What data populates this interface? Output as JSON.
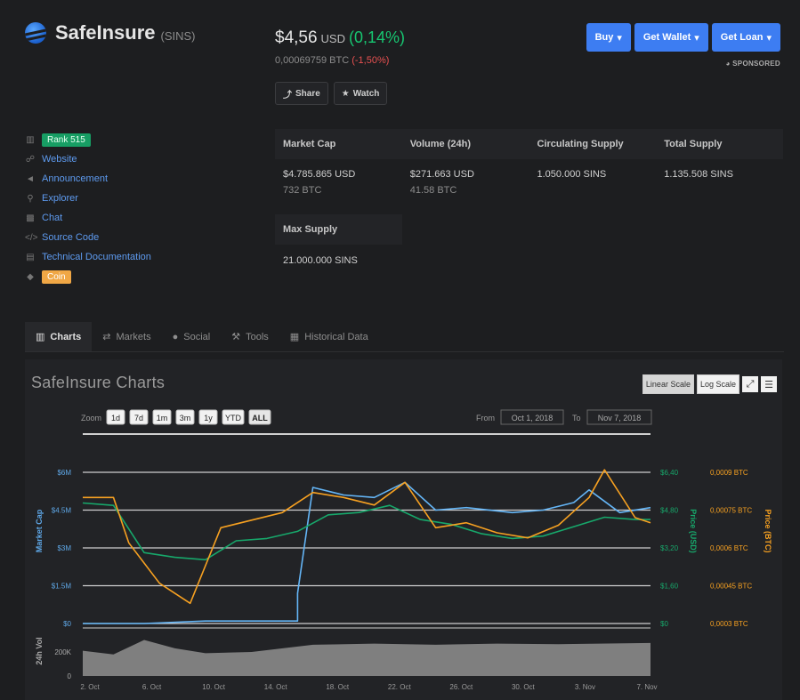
{
  "coin": {
    "name": "SafeInsure",
    "symbol": "(SINS)"
  },
  "price": {
    "usd": "$4,56",
    "usd_unit": "USD",
    "usd_change": "(0,14%)",
    "btc": "0,00069759 BTC",
    "btc_change": "(-1,50%)"
  },
  "buttons": {
    "share": "Share",
    "watch": "Watch",
    "buy": "Buy",
    "get_wallet": "Get Wallet",
    "get_loan": "Get Loan",
    "sponsored": "SPONSORED"
  },
  "links": {
    "rank": "Rank 515",
    "website": "Website",
    "announcement": "Announcement",
    "explorer": "Explorer",
    "chat": "Chat",
    "source_code": "Source Code",
    "technical_docs": "Technical Documentation",
    "coin_tag": "Coin"
  },
  "stats": {
    "headers": [
      "Market Cap",
      "Volume (24h)",
      "Circulating Supply",
      "Total Supply"
    ],
    "market_cap": {
      "usd": "$4.785.865 USD",
      "btc": "732 BTC"
    },
    "volume": {
      "usd": "$271.663 USD",
      "btc": "41.58 BTC"
    },
    "circulating": "1.050.000 SINS",
    "total": "1.135.508 SINS",
    "max_header": "Max Supply",
    "max": "21.000.000 SINS"
  },
  "tabs": [
    "Charts",
    "Markets",
    "Social",
    "Tools",
    "Historical Data"
  ],
  "colors": {
    "accent": "#3d7df2",
    "positive": "#17c671",
    "negative": "#e85151",
    "market_cap_line": "#64b5f6",
    "usd_line": "#17a86b",
    "btc_line": "#f7a121",
    "volume_bars": "#8a8a8a"
  },
  "chart_data": {
    "type": "line",
    "title": "SafeInsure Charts",
    "zoom_label": "Zoom",
    "zoom_buttons": [
      "1d",
      "7d",
      "1m",
      "3m",
      "1y",
      "YTD",
      "ALL"
    ],
    "zoom_selected": "ALL",
    "from_label": "From",
    "from": "Oct 1, 2018",
    "to_label": "To",
    "to": "Nov 7, 2018",
    "scale_buttons": [
      "Linear Scale",
      "Log Scale"
    ],
    "x_ticks": [
      "2. Oct",
      "6. Oct",
      "10. Oct",
      "14. Oct",
      "18. Oct",
      "22. Oct",
      "26. Oct",
      "30. Oct",
      "3. Nov",
      "7. Nov"
    ],
    "left_axis": {
      "label": "Market Cap",
      "ticks": [
        "$0",
        "$1.5M",
        "$3M",
        "$4.5M",
        "$6M"
      ],
      "range": [
        0,
        6000000
      ]
    },
    "usd_axis": {
      "label": "Price (USD)",
      "ticks": [
        "$0",
        "$1,60",
        "$3,20",
        "$4,80",
        "$6,40"
      ],
      "range": [
        0,
        6.4
      ]
    },
    "btc_axis": {
      "label": "Price (BTC)",
      "ticks": [
        "0,0003 BTC",
        "0,00045 BTC",
        "0,0006 BTC",
        "0,00075 BTC",
        "0,0009 BTC"
      ],
      "range": [
        0.0003,
        0.0009
      ]
    },
    "volume_axis": {
      "label": "24h Vol",
      "ticks": [
        "0",
        "200K"
      ],
      "range": [
        0,
        400000
      ]
    },
    "series": [
      {
        "name": "Market Cap",
        "x": [
          "2018-10-01",
          "2018-10-04",
          "2018-10-05",
          "2018-10-09",
          "2018-10-15",
          "2018-10-15",
          "2018-10-16",
          "2018-10-18",
          "2018-10-20",
          "2018-10-22",
          "2018-10-24",
          "2018-10-26",
          "2018-10-29",
          "2018-10-31",
          "2018-11-02",
          "2018-11-03",
          "2018-11-05",
          "2018-11-07"
        ],
        "values": [
          0,
          0,
          0,
          100000,
          100000,
          1200000,
          5400000,
          5100000,
          5000000,
          5600000,
          4500000,
          4600000,
          4400000,
          4500000,
          4800000,
          5300000,
          4400000,
          4600000
        ]
      },
      {
        "name": "Price (USD)",
        "x": [
          "2018-10-01",
          "2018-10-03",
          "2018-10-05",
          "2018-10-07",
          "2018-10-09",
          "2018-10-11",
          "2018-10-13",
          "2018-10-15",
          "2018-10-17",
          "2018-10-19",
          "2018-10-21",
          "2018-10-23",
          "2018-10-25",
          "2018-10-27",
          "2018-10-29",
          "2018-10-31",
          "2018-11-02",
          "2018-11-04",
          "2018-11-06",
          "2018-11-07"
        ],
        "values": [
          5.1,
          5.0,
          3.0,
          2.8,
          2.7,
          3.5,
          3.6,
          3.9,
          4.6,
          4.7,
          5.0,
          4.4,
          4.2,
          3.8,
          3.6,
          3.7,
          4.1,
          4.5,
          4.4,
          4.4
        ]
      },
      {
        "name": "Price (BTC)",
        "x": [
          "2018-10-01",
          "2018-10-03",
          "2018-10-04",
          "2018-10-06",
          "2018-10-08",
          "2018-10-10",
          "2018-10-12",
          "2018-10-14",
          "2018-10-16",
          "2018-10-18",
          "2018-10-20",
          "2018-10-22",
          "2018-10-24",
          "2018-10-26",
          "2018-10-28",
          "2018-10-30",
          "2018-11-01",
          "2018-11-03",
          "2018-11-04",
          "2018-11-06",
          "2018-11-07"
        ],
        "values": [
          0.0008,
          0.0008,
          0.00062,
          0.00046,
          0.00038,
          0.00068,
          0.00071,
          0.00074,
          0.00082,
          0.0008,
          0.00077,
          0.00086,
          0.00068,
          0.0007,
          0.00066,
          0.00064,
          0.00069,
          0.0008,
          0.00091,
          0.00072,
          0.0007
        ]
      },
      {
        "name": "24h Vol",
        "x": [
          "2018-10-01",
          "2018-10-03",
          "2018-10-05",
          "2018-10-07",
          "2018-10-09",
          "2018-10-12",
          "2018-10-16",
          "2018-10-20",
          "2018-10-24",
          "2018-10-28",
          "2018-11-01",
          "2018-11-07"
        ],
        "values": [
          210000,
          180000,
          300000,
          230000,
          190000,
          200000,
          260000,
          270000,
          260000,
          270000,
          265000,
          275000
        ]
      }
    ]
  }
}
